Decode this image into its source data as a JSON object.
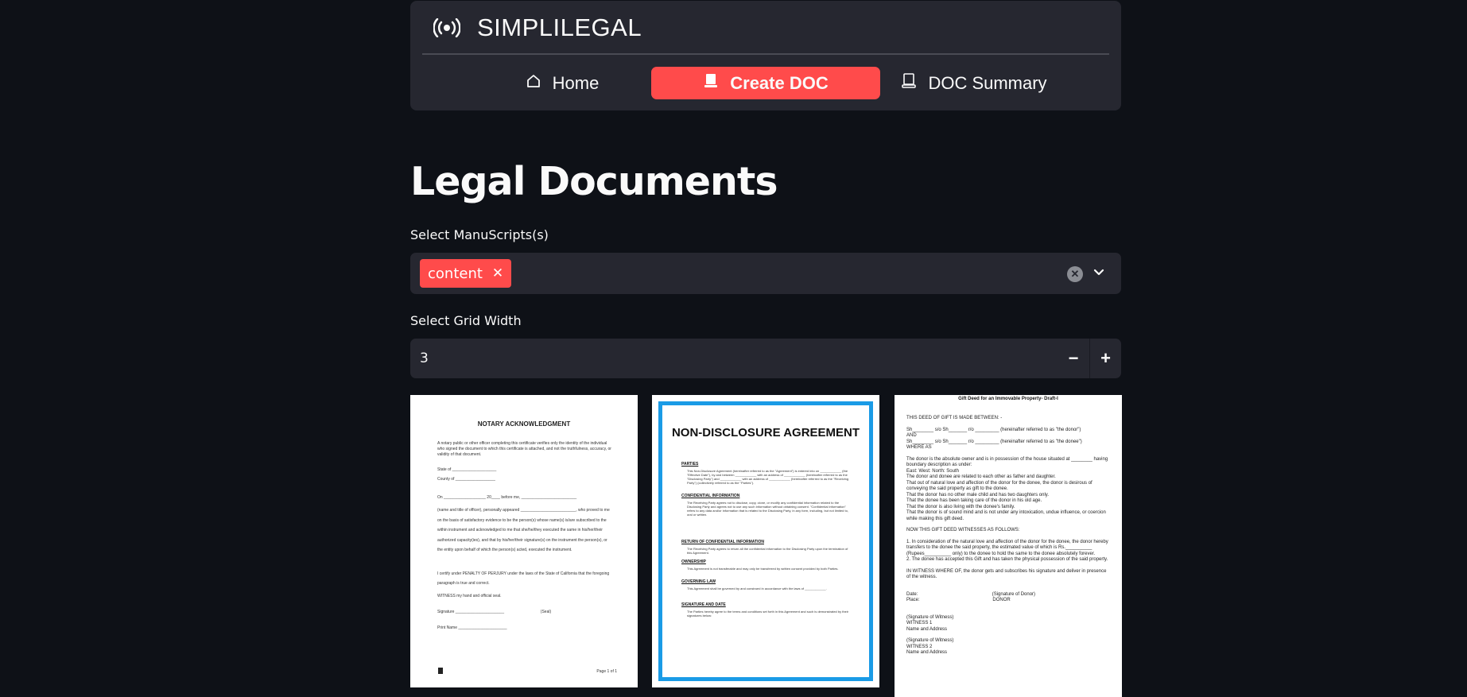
{
  "app": {
    "title": "SIMPLILEGAL",
    "nav": [
      {
        "label": "Home",
        "icon": "house-icon",
        "active": false
      },
      {
        "label": "Create DOC",
        "icon": "document-icon",
        "active": true
      },
      {
        "label": "DOC Summary",
        "icon": "document-icon",
        "active": false
      }
    ],
    "accent_color": "#ff4b4b"
  },
  "main": {
    "page_title": "Legal Documents",
    "manuscripts": {
      "label": "Select ManuScripts(s)",
      "selected": [
        "content"
      ]
    },
    "grid_width": {
      "label": "Select Grid Width",
      "value": "3",
      "decrement": "−",
      "increment": "+"
    }
  },
  "documents": [
    {
      "title": "NOTARY ACKNOWLEDGMENT",
      "intro": "A notary public or other officer completing this certificate verifies only the identity of the individual who signed the document to which this certificate is attached, and not the truthfulness, accuracy, or validity of that document.",
      "state": "State of ____________________",
      "county": "County of __________________",
      "on": "On ___________________ 20____ before me, _________________________",
      "body": "(name and title of officer), personally appeared _________________________, who proved to me on the basis of satisfactory evidence to be the person(s) whose name(s) is/are subscribed to the within instrument and acknowledged to me that she/he/they executed the same in his/her/their authorized capacity(ies), and that by his/her/their signature(s) on the instrument the person(s), or the entity upon behalf of which the person(s) acted, executed the instrument.",
      "perjury": "I certify under PENALTY OF PERJURY under the laws of the State of California that the foregoing paragraph is true and correct.",
      "witness": "WITNESS my hand and official seal.",
      "signature": "Signature ______________________                                 (Seal)",
      "print_name": "Print Name ______________________",
      "page": "Page 1 of 1"
    },
    {
      "title": "NON-DISCLOSURE AGREEMENT",
      "sections": [
        {
          "heading": "PARTIES",
          "text": "This Non-Disclosure Agreement (hereinafter referred to as the \"Agreement\") is entered into on ____________ (the \"Effective Date\"), by and between ____________ with an address of ____________ (hereinafter referred to as the \"Disclosing Party\") and ____________ with an address of ____________ (hereinafter referred to as the \"Receiving Party\") (collectively referred to as the \"Parties\")."
        },
        {
          "heading": "CONFIDENTIAL INFORMATION",
          "text": "The Receiving Party agrees not to disclose, copy, clone, or modify any confidential information related to the Disclosing Party and agrees not to use any such information without obtaining consent. \"Confidential information\" refers to any data and/or information that is related to the Disclosing Party, in any form, including, but not limited to, oral or written."
        },
        {
          "heading": "RETURN OF CONFIDENTIAL INFORMATION",
          "text": "The Receiving Party agrees to return all the confidential information to the Disclosing Party upon the termination of this Agreement."
        },
        {
          "heading": "OWNERSHIP",
          "text": "This Agreement is not transferable and may only be transferred by written consent provided by both Parties."
        },
        {
          "heading": "GOVERNING LAW",
          "text": "This Agreement shall be governed by and construed in accordance with the laws of ____________."
        },
        {
          "heading": "SIGNATURE AND DATE",
          "text": "The Parties hereby agree to the terms and conditions set forth in this Agreement and such is demonstrated by their signatures below:"
        }
      ]
    },
    {
      "title": "Gift Deed for an Immovable Property- Draft-I",
      "lines": [
        "THIS DEED OF GIFT IS MADE BETWEEN: -",
        "",
        "Sh________ s/o Sh_______ r/o _________ (hereinafter referred to as \"the donor\")",
        "AND",
        "Sh________ s/o Sh_______ r/o _________ (hereinafter referred to as \"the donee\")",
        "WHERE AS",
        "",
        "The donor is the absolute owner and is in possession of the house situated at ________ having boundary description as under:",
        "East: West: North: South",
        "The donor and donee are related to each other as father and daughter.",
        "That out of natural love and affection of the donor for the donee, the donor is desirous of conveying the said property as gift to the donee.",
        "That the donor has no other male child and has two daughters only.",
        "That the donee has been taking care of the donor in his old age.",
        "That the donor is also living with the donee's family.",
        "That the donor is of sound mind and is not under any intoxication, undue influence, or coercion while making this gift deed.",
        "",
        "NOW THIS GIFT DEED WITNESSES AS FOLLOWS:",
        "",
        "1. In consideration of the natural love and affection of the donor for the donee, the donor hereby transfers to the donee the said property, the estimated value of which is Rs.__________ (Rupees__________ only) to the donee to hold the same to the donee absolutely forever.",
        "2. The donee has accepted this Gift and has taken the physical possession of the said property.",
        "",
        "IN WITNESS WHERE OF, the donor gets and subscribes his signature and deliver in presence of the witness.",
        "",
        "",
        "Date:                                                        (Signature of Donor)",
        "Place:                                                       DONOR",
        "",
        "",
        "(Signature of Witness)",
        "WITNESS 1",
        "Name and Address",
        "",
        "(Signature of Witness)",
        "WITNESS 2",
        "Name and Address"
      ]
    }
  ]
}
